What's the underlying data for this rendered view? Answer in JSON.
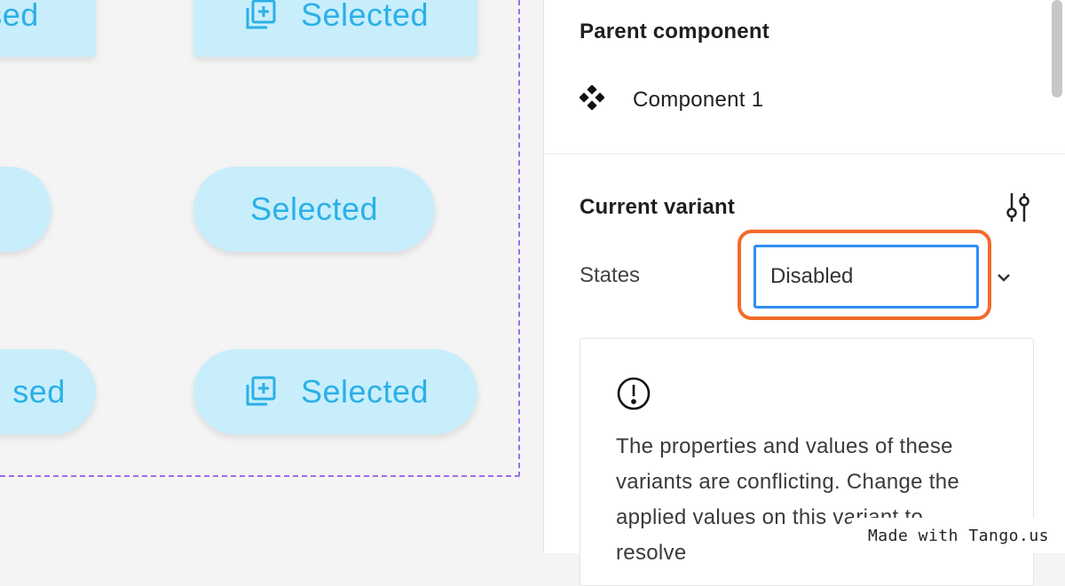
{
  "canvas": {
    "buttons": [
      {
        "label": "sed",
        "icon": "none"
      },
      {
        "label": "Selected",
        "icon": "add-layer-icon"
      },
      {
        "label": "",
        "icon": "none"
      },
      {
        "label": "Selected",
        "icon": "none"
      },
      {
        "label": "sed",
        "icon": "none"
      },
      {
        "label": "Selected",
        "icon": "add-layer-icon"
      }
    ]
  },
  "panel": {
    "parent_component": {
      "title": "Parent component",
      "name": "Component 1",
      "icon": "component-icon"
    },
    "current_variant": {
      "title": "Current variant",
      "adjust_icon": "adjust-icon",
      "property_label": "States",
      "property_value": "Disabled",
      "dropdown_icon": "chevron-down-icon"
    },
    "warning": {
      "icon": "exclamation-circle-icon",
      "text": "The properties and values of these variants are conflicting. Change the applied values on this variant to resolve"
    }
  },
  "watermark": "Made with Tango.us",
  "colors": {
    "pill_bg": "#c8eefc",
    "pill_text": "#2bb0e6",
    "highlight": "#f26b2a",
    "input_border": "#2d8ef5",
    "frame_border": "#9d6bf0"
  }
}
